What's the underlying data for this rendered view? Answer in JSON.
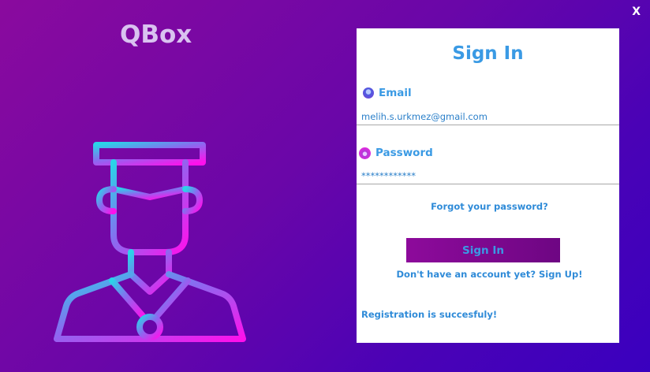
{
  "app": {
    "title": "QBox",
    "close_label": "X"
  },
  "login": {
    "heading": "Sign In",
    "email": {
      "label": "Email",
      "value": "melih.s.urkmez@gmail.com",
      "icon": "user-icon"
    },
    "password": {
      "label": "Password",
      "value": "************",
      "icon": "lock-icon"
    },
    "forgot_link": "Forgot your password?",
    "submit_label": "Sign In",
    "signup_link": "Don't have an account yet? Sign Up!",
    "status_message": "Registration is succesfuly!"
  },
  "illustration": {
    "icon": "graduate-student-icon"
  },
  "colors": {
    "accent": "#3a9ae4",
    "bg_start": "#8a0a9e",
    "bg_end": "#3a00bf",
    "button_start": "#8d0a9b",
    "button_end": "#6e0683",
    "illustration_start": "#2ad4e8",
    "illustration_end": "#ff10ec"
  }
}
